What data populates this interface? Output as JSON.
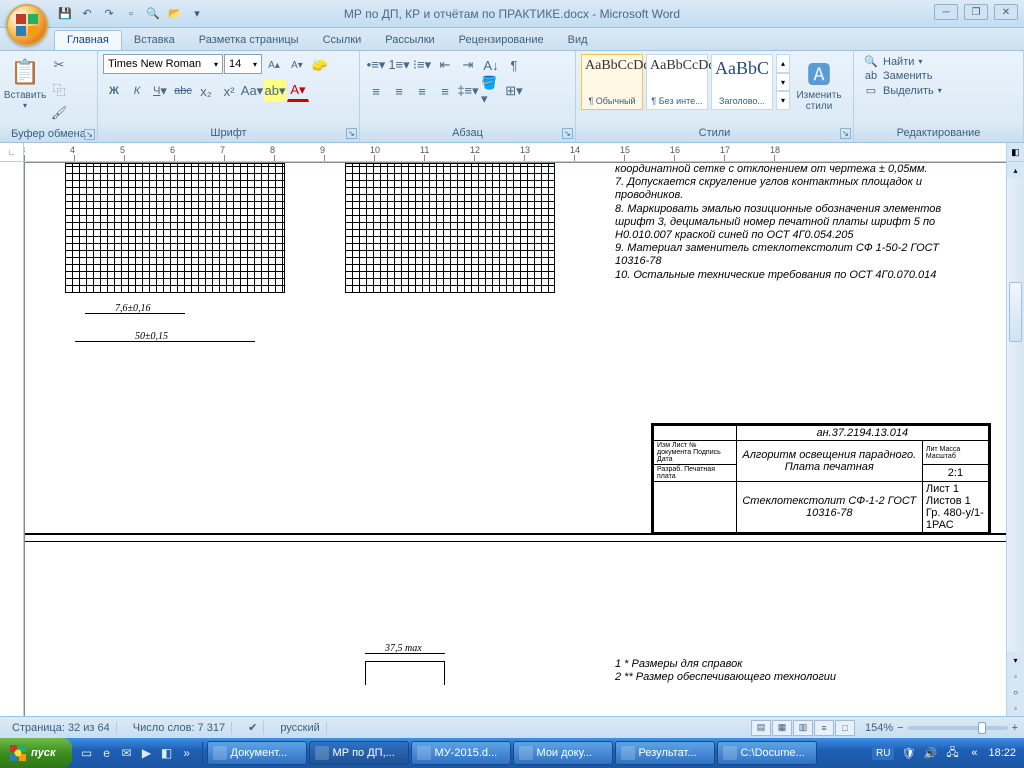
{
  "title": "МР по ДП, КР и отчётам по ПРАКТИКЕ.docx - Microsoft Word",
  "tabs": [
    "Главная",
    "Вставка",
    "Разметка страницы",
    "Ссылки",
    "Рассылки",
    "Рецензирование",
    "Вид"
  ],
  "active_tab": 0,
  "clipboard": {
    "label": "Буфер обмена",
    "paste": "Вставить"
  },
  "font": {
    "group": "Шрифт",
    "name": "Times New Roman",
    "size": "14"
  },
  "para": {
    "group": "Абзац"
  },
  "styles": {
    "group": "Стили",
    "items": [
      {
        "sample": "AaBbCcDd",
        "name": "¶ Обычный"
      },
      {
        "sample": "AaBbCcDd",
        "name": "¶ Без инте..."
      },
      {
        "sample": "AaBbC",
        "name": "Заголово..."
      }
    ],
    "change": "Изменить стили"
  },
  "editing": {
    "group": "Редактирование",
    "find": "Найти",
    "replace": "Заменить",
    "select": "Выделить"
  },
  "ruler_start": 3,
  "doc_notes": [
    "координатной сетке с отклонением от чертежа ± 0,05мм.",
    "7. Допускается скругление углов контактных площадок и проводников.",
    "8. Маркировать эмалью позиционные обозначения элементов шрифт 3, децимальный номер печатной платы шрифт 5 по Н0.010.007 краской синей по ОСТ 4Г0.054.205",
    "9. Материал заменитель стеклотекстолит СФ 1-50-2 ГОСТ 10316-78",
    "10. Остальные технические требования по ОСТ 4Г0.070.014"
  ],
  "dims": {
    "d1": "7,6±0,16",
    "d2": "50±0,15",
    "d3": "37,5 max"
  },
  "titleblock": {
    "r1": "ан.37.2194.13.014",
    "r2": "Изм Лист № документа Подпись Дата",
    "r3": "Разраб. Печатная плата",
    "r4": "Алгоритм освещения парадного. Плата печатная",
    "r5": "Лит Масса Масштаб",
    "r6": "2:1",
    "r7": "Лист 1  Листов 1",
    "r8": "Стеклотекстолит СФ-1-2 ГОСТ 10316-78",
    "r9": "Гр. 480-у/1-1РАС"
  },
  "footnotes": [
    "1 * Размеры для справок",
    "2 ** Размер обеспечивающего технологии"
  ],
  "status": {
    "page": "Страница: 32 из 64",
    "words": "Число слов: 7 317",
    "lang": "русский",
    "zoom": "154%"
  },
  "taskbar": {
    "start": "пуск",
    "tasks": [
      {
        "label": "Документ..."
      },
      {
        "label": "МР по ДП,..."
      },
      {
        "label": "МУ-2015.d..."
      },
      {
        "label": "Мои доку..."
      },
      {
        "label": "Результат..."
      },
      {
        "label": "C:\\Docume..."
      }
    ],
    "lang": "RU",
    "time": "18:22"
  }
}
